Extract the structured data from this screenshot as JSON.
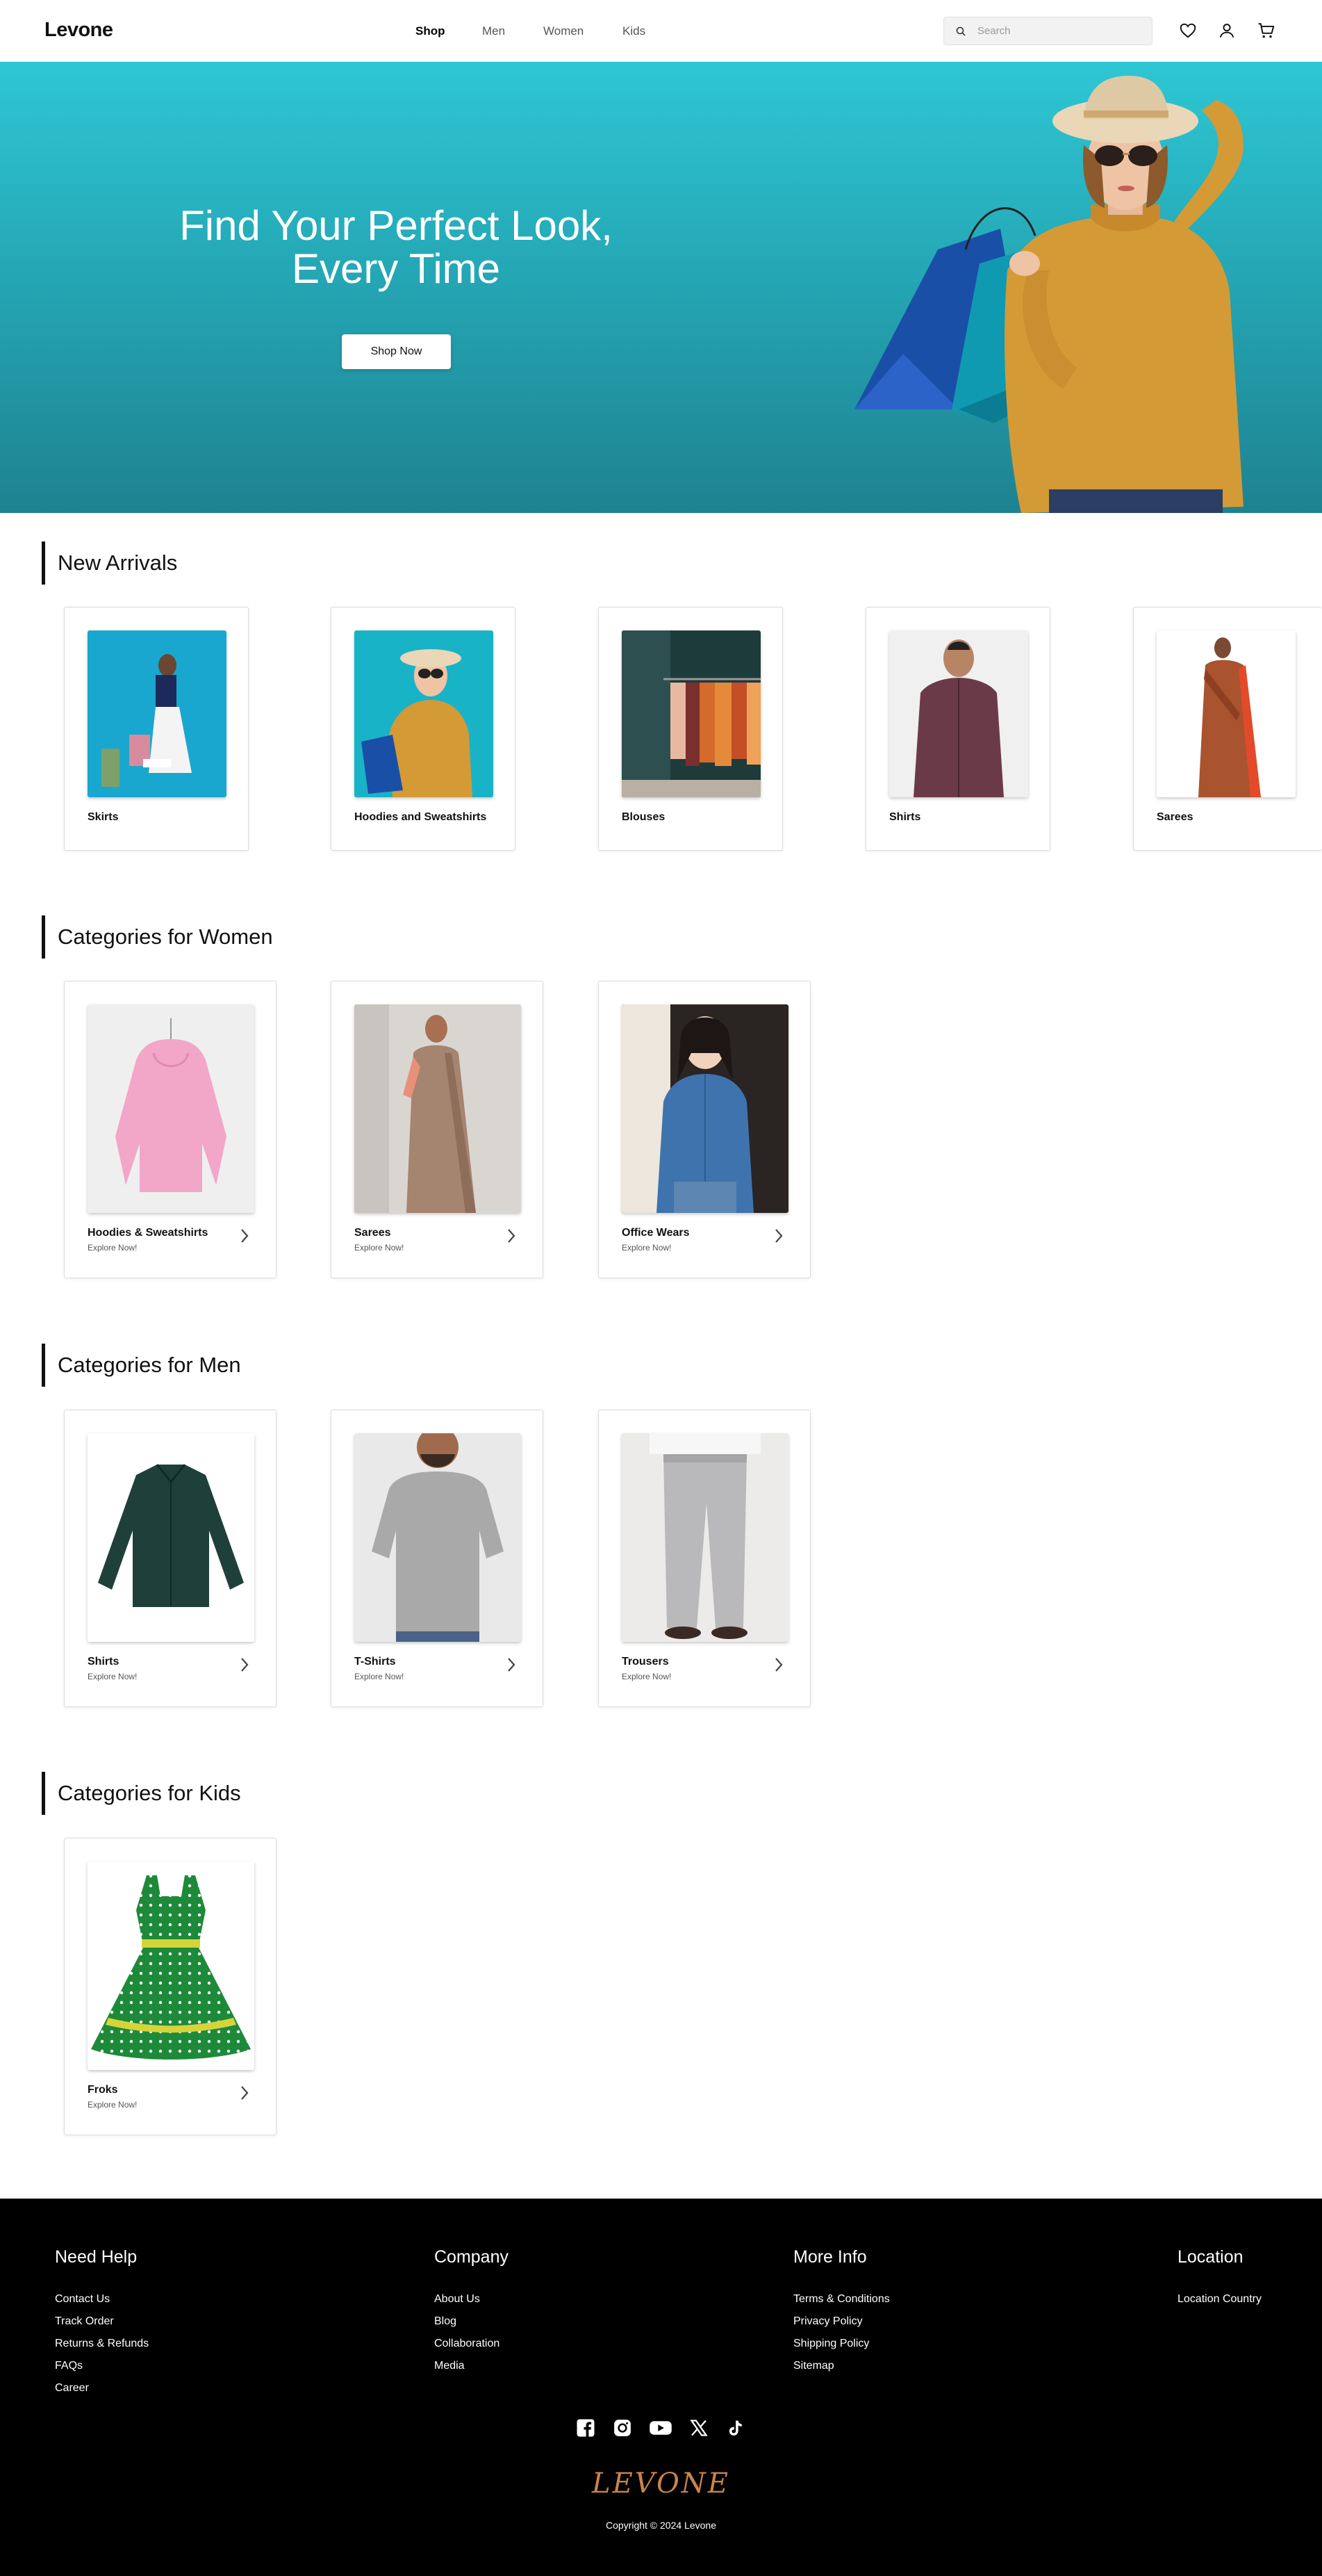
{
  "header": {
    "logo": "Levone",
    "nav": [
      {
        "label": "Shop",
        "active": true
      },
      {
        "label": "Men",
        "active": false
      },
      {
        "label": "Women",
        "active": false
      },
      {
        "label": "Kids",
        "active": false
      }
    ],
    "search_placeholder": "Search",
    "icons": [
      "heart-icon",
      "user-icon",
      "cart-icon"
    ]
  },
  "hero": {
    "title_line1": "Find Your Perfect Look,",
    "title_line2": "Every Time",
    "button": "Shop Now",
    "colors": {
      "top": "#2ec7d4",
      "bottom": "#1e8290"
    }
  },
  "new_arrivals": {
    "title": "New Arrivals",
    "items": [
      {
        "name": "Skirts"
      },
      {
        "name": "Hoodies and Sweatshirts"
      },
      {
        "name": "Blouses"
      },
      {
        "name": "Shirts"
      },
      {
        "name": "Sarees"
      }
    ]
  },
  "women": {
    "title": "Categories for Women",
    "items": [
      {
        "name": "Hoodies & Sweatshirts",
        "sub": "Explore Now!"
      },
      {
        "name": "Sarees",
        "sub": "Explore Now!"
      },
      {
        "name": "Office Wears",
        "sub": "Explore Now!"
      }
    ]
  },
  "men": {
    "title": "Categories for Men",
    "items": [
      {
        "name": "Shirts",
        "sub": "Explore Now!"
      },
      {
        "name": "T-Shirts",
        "sub": "Explore Now!"
      },
      {
        "name": "Trousers",
        "sub": "Explore Now!"
      }
    ]
  },
  "kids": {
    "title": "Categories for Kids",
    "items": [
      {
        "name": "Froks",
        "sub": "Explore Now!"
      }
    ]
  },
  "footer": {
    "need_help": {
      "title": "Need Help",
      "links": [
        "Contact Us",
        "Track Order",
        "Returns & Refunds",
        "FAQs",
        "Career"
      ]
    },
    "company": {
      "title": "Company",
      "links": [
        "About Us",
        "Blog",
        "Collaboration",
        "Media"
      ]
    },
    "more_info": {
      "title": "More Info",
      "links": [
        "Terms & Conditions",
        "Privacy Policy",
        "Shipping Policy",
        "Sitemap"
      ]
    },
    "location": {
      "title": "Location",
      "links": [
        "Location Country"
      ]
    },
    "socials": [
      "facebook-icon",
      "instagram-icon",
      "youtube-icon",
      "x-icon",
      "tiktok-icon"
    ],
    "brand_script": "LEVONE",
    "copyright": "Copyright © 2024 Levone",
    "brand_color": "#c9844a"
  }
}
